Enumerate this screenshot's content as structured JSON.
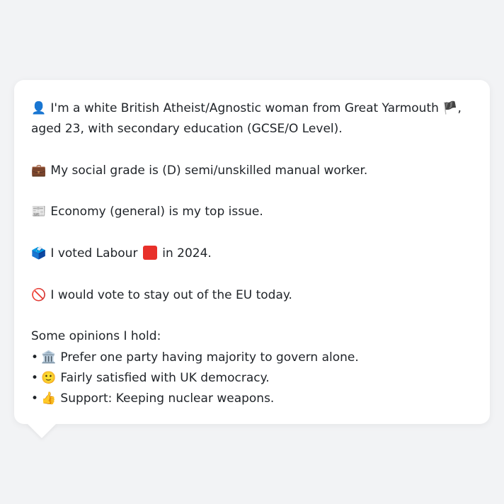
{
  "profile": {
    "intro": {
      "icon": "person-silhouette-icon",
      "emoji": "👤",
      "text_before_flag": "I'm a white British Atheist/Agnostic woman from Great Yarmouth",
      "flag_emoji": "🏴",
      "flag_icon": "england-flag-icon",
      "text_after_flag": ", aged 23, with secondary education (GCSE/O Level)."
    },
    "social_grade": {
      "icon": "briefcase-icon",
      "emoji": "💼",
      "text": "My social grade is (D) semi/unskilled manual worker."
    },
    "top_issue": {
      "icon": "newspaper-icon",
      "emoji": "📰",
      "text": "Economy (general) is my top issue."
    },
    "vote": {
      "icon": "ballot-box-icon",
      "emoji": "🗳️",
      "text_before": "I voted Labour",
      "party_color_icon": "red-square-icon",
      "party_color": "#e8302a",
      "text_after": "in 2024."
    },
    "eu": {
      "icon": "prohibited-icon",
      "emoji": "🚫",
      "text": "I would vote to stay out of the EU today."
    },
    "opinions_heading": "Some opinions I hold:",
    "opinions": [
      {
        "bullet": "•",
        "icon": "classical-building-icon",
        "emoji": "🏛️",
        "text": "Prefer one party having majority to govern alone."
      },
      {
        "bullet": "•",
        "icon": "slightly-smiling-face-icon",
        "emoji": "🙂",
        "text": "Fairly satisfied with UK democracy."
      },
      {
        "bullet": "•",
        "icon": "thumbs-up-icon",
        "emoji": "👍",
        "text": "Support: Keeping nuclear weapons."
      }
    ]
  },
  "colors": {
    "page_background": "#f2f3f5",
    "bubble_background": "#ffffff",
    "text": "#1f2328"
  }
}
